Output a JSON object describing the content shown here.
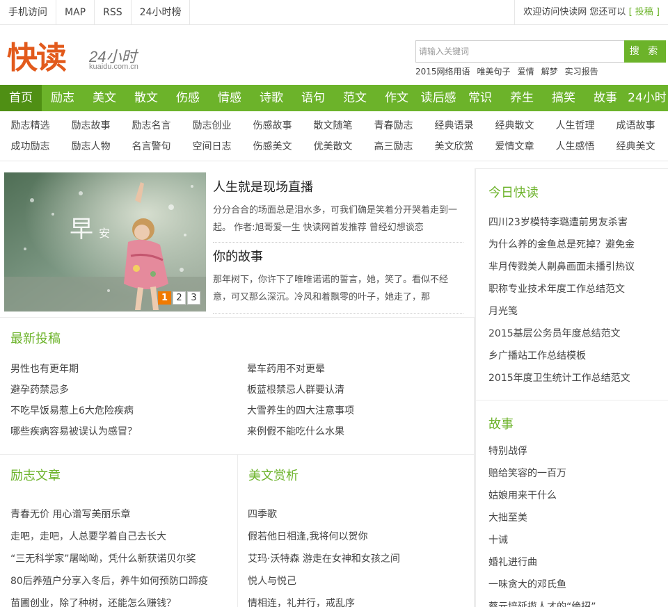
{
  "topbar": {
    "links": [
      "手机访问",
      "MAP",
      "RSS",
      "24小时榜"
    ],
    "welcome": "欢迎访问快读网 您还可以",
    "submit": "[ 投稿 ]"
  },
  "header": {
    "logo_cn": "快读",
    "logo_num": "24小时",
    "logo_domain": "kuaidu.com.cn",
    "search_placeholder": "请输入关键词",
    "search_button": "搜 索",
    "hot_keywords": [
      "2015网络用语",
      "唯美句子",
      "爱情",
      "解梦",
      "实习报告"
    ]
  },
  "nav": [
    "首页",
    "励志",
    "美文",
    "散文",
    "伤感",
    "情感",
    "诗歌",
    "语句",
    "范文",
    "作文",
    "读后感",
    "常识",
    "养生",
    "搞笑",
    "故事",
    "24小时"
  ],
  "subnav": {
    "row1": [
      "励志精选",
      "励志故事",
      "励志名言",
      "励志创业",
      "伤感故事",
      "散文随笔",
      "青春励志",
      "经典语录",
      "经典散文",
      "人生哲理",
      "成语故事"
    ],
    "row2": [
      "成功励志",
      "励志人物",
      "名言警句",
      "空间日志",
      "伤感美文",
      "优美散文",
      "高三励志",
      "美文欣赏",
      "爱情文章",
      "人生感悟",
      "经典美文"
    ]
  },
  "slider": {
    "overlay_text_big": "早",
    "overlay_text_small": "安",
    "pages": [
      "1",
      "2",
      "3"
    ]
  },
  "features": [
    {
      "title": "人生就是现场直播",
      "desc": "分分合合的场面总是泪水多，可我们确是笑着分开哭着走到一起。 作者:旭哥爱一生 快读网首发推荐 曾经幻想谈恋"
    },
    {
      "title": "你的故事",
      "desc": "那年树下，你许下了唯唯诺诺的誓言，她，笑了。看似不经意，可又那么深沉。冷风和着飘零的叶子，她走了，那"
    }
  ],
  "latest": {
    "title": "最新投稿",
    "left": [
      "男性也有更年期",
      "避孕药禁忌多",
      "不吃早饭易惹上6大危险疾病",
      "哪些疾病容易被误认为感冒？"
    ],
    "right": [
      "晕车药用不对更晕",
      "板蓝根禁忌人群要认清",
      "大雪养生的四大注意事项",
      "来例假不能吃什么水果"
    ]
  },
  "lizhi": {
    "title": "励志文章",
    "items": [
      "青春无价 用心谱写美丽乐章",
      "走吧，走吧，人总要学着自己去长大",
      "“三无科学家”屠呦呦，凭什么新获诺贝尔奖",
      "80后养殖户分享入冬后，养牛如何预防口蹄疫",
      "苗圃创业，除了种树，还能怎么赚钱？"
    ]
  },
  "meiwen": {
    "title": "美文赏析",
    "items": [
      "四季歌",
      "假若他日相逢,我将何以贺你",
      "艾玛·沃特森 游走在女神和女孩之间",
      "悦人与悦己",
      "情相连，礼并行，戒乱序"
    ]
  },
  "today": {
    "title": "今日快读",
    "items": [
      "四川23岁模特李璐遭前男友杀害",
      "为什么养的金鱼总是死掉？避免金",
      "芈月传戮美人劓鼻画面未播引热议",
      "职称专业技术年度工作总结范文",
      "月光笺",
      "2015基层公务员年度总结范文",
      "乡广播站工作总结模板",
      "2015年度卫生统计工作总结范文"
    ]
  },
  "story": {
    "title": "故事",
    "items": [
      "特别战俘",
      "赔给笑容的一百万",
      "姑娘用来干什么",
      "大拙至美",
      "十诫",
      "婚礼进行曲",
      "一味贪大的邓氏鱼",
      "蔡元培延揽人才的“绝招”"
    ]
  }
}
